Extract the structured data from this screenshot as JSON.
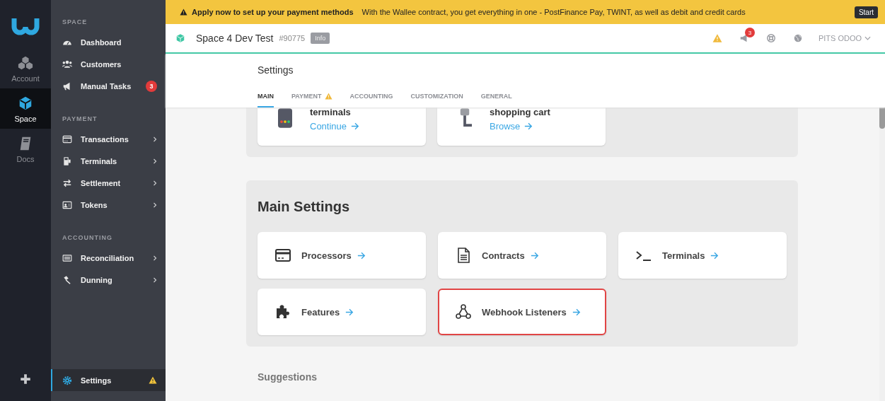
{
  "rail": {
    "items": [
      {
        "label": "Account",
        "kind": "cubes",
        "selected": false
      },
      {
        "label": "Space",
        "kind": "cube",
        "selected": true
      },
      {
        "label": "Docs",
        "kind": "book",
        "selected": false
      }
    ]
  },
  "nav": {
    "sections": [
      {
        "title": "SPACE",
        "items": [
          {
            "label": "Dashboard",
            "kind": "gauge",
            "submenu": false
          },
          {
            "label": "Customers",
            "kind": "users",
            "submenu": false
          },
          {
            "label": "Manual Tasks",
            "kind": "megaphone",
            "submenu": false,
            "badge": "3"
          }
        ]
      },
      {
        "title": "PAYMENT",
        "items": [
          {
            "label": "Transactions",
            "kind": "card",
            "submenu": true
          },
          {
            "label": "Terminals",
            "kind": "device",
            "submenu": true
          },
          {
            "label": "Settlement",
            "kind": "arrows",
            "submenu": true
          },
          {
            "label": "Tokens",
            "kind": "idcard",
            "submenu": true
          }
        ]
      },
      {
        "title": "ACCOUNTING",
        "items": [
          {
            "label": "Reconciliation",
            "kind": "ledger",
            "submenu": true
          },
          {
            "label": "Dunning",
            "kind": "gavel",
            "submenu": true
          }
        ]
      }
    ],
    "footer": {
      "label": "Settings",
      "selected": true,
      "warning": true
    }
  },
  "banner": {
    "title": "Apply now to set up your payment methods",
    "message": "With the Wallee contract, you get everything in one - PostFinance Pay, TWINT, as well as debit and credit cards",
    "button": "Start"
  },
  "header": {
    "space_name": "Space 4 Dev Test",
    "space_id": "#90775",
    "info": "Info",
    "notifications": "3",
    "user": "PITS ODOO"
  },
  "page": {
    "title": "Settings",
    "tabs": [
      {
        "label": "MAIN",
        "selected": true,
        "warning": false
      },
      {
        "label": "PAYMENT",
        "selected": false,
        "warning": true
      },
      {
        "label": "ACCOUNTING",
        "selected": false,
        "warning": false
      },
      {
        "label": "CUSTOMIZATION",
        "selected": false,
        "warning": false
      },
      {
        "label": "GENERAL",
        "selected": false,
        "warning": false
      }
    ],
    "top_cards": [
      {
        "title": "terminals",
        "link": "Continue",
        "kind": "pos"
      },
      {
        "title": "shopping cart",
        "link": "Browse",
        "kind": "plug"
      }
    ],
    "main_settings": {
      "title": "Main Settings",
      "cards": [
        {
          "label": "Processors",
          "kind": "card",
          "highlighted": false
        },
        {
          "label": "Contracts",
          "kind": "document",
          "highlighted": false
        },
        {
          "label": "Terminals",
          "kind": "prompt",
          "highlighted": false
        },
        {
          "label": "Features",
          "kind": "puzzle",
          "highlighted": false
        },
        {
          "label": "Webhook Listeners",
          "kind": "webhook",
          "highlighted": true
        }
      ]
    },
    "suggestions_title": "Suggestions"
  }
}
